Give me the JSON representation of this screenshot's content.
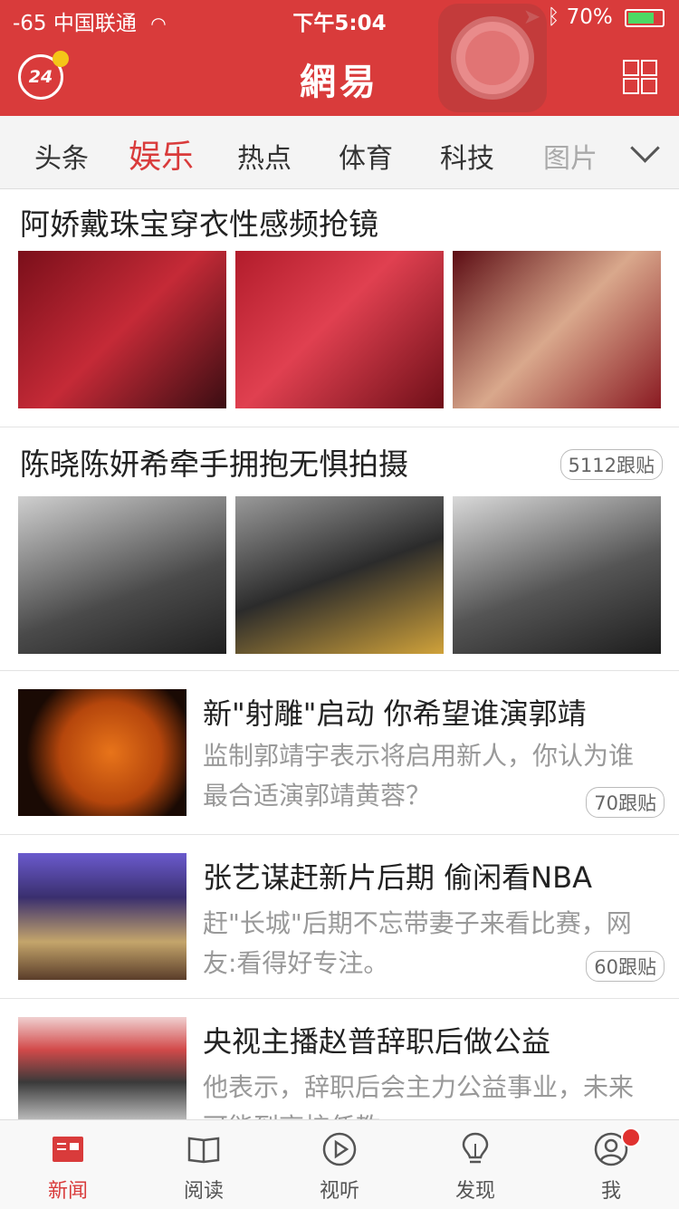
{
  "status_bar": {
    "signal": "-65 中国联通",
    "time": "下午5:04",
    "battery": "70%"
  },
  "header": {
    "badge_number": "24",
    "logo": "網易"
  },
  "tabs": [
    "头条",
    "娱乐",
    "热点",
    "体育",
    "科技",
    "图片"
  ],
  "articles": [
    {
      "title": "阿娇戴珠宝穿衣性感频抢镜",
      "counter": ""
    },
    {
      "title": "陈晓陈妍希牵手拥抱无惧拍摄",
      "counter": "5112跟贴"
    },
    {
      "title": "新\"射雕\"启动 你希望谁演郭靖",
      "desc": "监制郭靖宇表示将启用新人，你认为谁最合适演郭靖黄蓉？",
      "counter": "70跟贴"
    },
    {
      "title": "张艺谋赶新片后期 偷闲看NBA",
      "desc": "赶\"长城\"后期不忘带妻子来看比赛，网友:看得好专注。",
      "counter": "60跟贴"
    },
    {
      "title": "央视主播赵普辞职后做公益",
      "desc": "他表示，辞职后会主力公益事业，未来可能到高校任教",
      "counter": ""
    }
  ],
  "tabbar": [
    "新闻",
    "阅读",
    "视听",
    "发现",
    "我"
  ],
  "colors": {
    "brand": "#d93b3b",
    "battery": "#4cd964"
  },
  "icons": [
    "wifi-icon",
    "location-icon",
    "bluetooth-icon",
    "grid-icon",
    "chevron-down-icon",
    "news-icon",
    "book-icon",
    "play-icon",
    "lightbulb-icon",
    "profile-icon"
  ]
}
